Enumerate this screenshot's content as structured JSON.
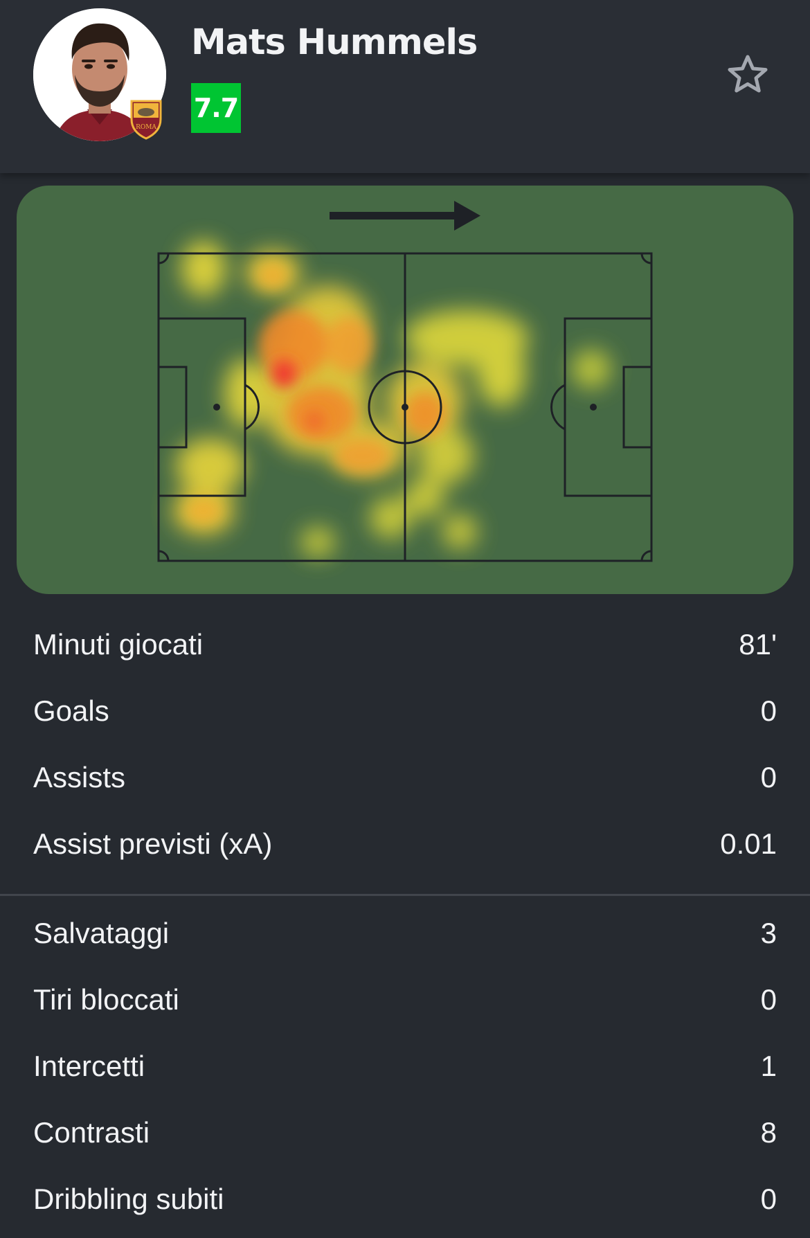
{
  "player": {
    "name": "Mats Hummels",
    "rating": "7.7",
    "rating_color": "#00c532",
    "club_badge_text": "ROMA"
  },
  "icons": {
    "favorite": "star-outline-icon",
    "direction": "arrow-right-icon"
  },
  "heatmap": {
    "attack_direction": "right",
    "pitch_color": "#466a45"
  },
  "stats_group_1": [
    {
      "label": "Minuti giocati",
      "value": "81'"
    },
    {
      "label": "Goals",
      "value": "0"
    },
    {
      "label": "Assists",
      "value": "0"
    },
    {
      "label": "Assist previsti (xA)",
      "value": "0.01"
    }
  ],
  "stats_group_2": [
    {
      "label": "Salvataggi",
      "value": "3"
    },
    {
      "label": "Tiri bloccati",
      "value": "0"
    },
    {
      "label": "Intercetti",
      "value": "1"
    },
    {
      "label": "Contrasti",
      "value": "8"
    },
    {
      "label": "Dribbling subiti",
      "value": "0"
    }
  ]
}
